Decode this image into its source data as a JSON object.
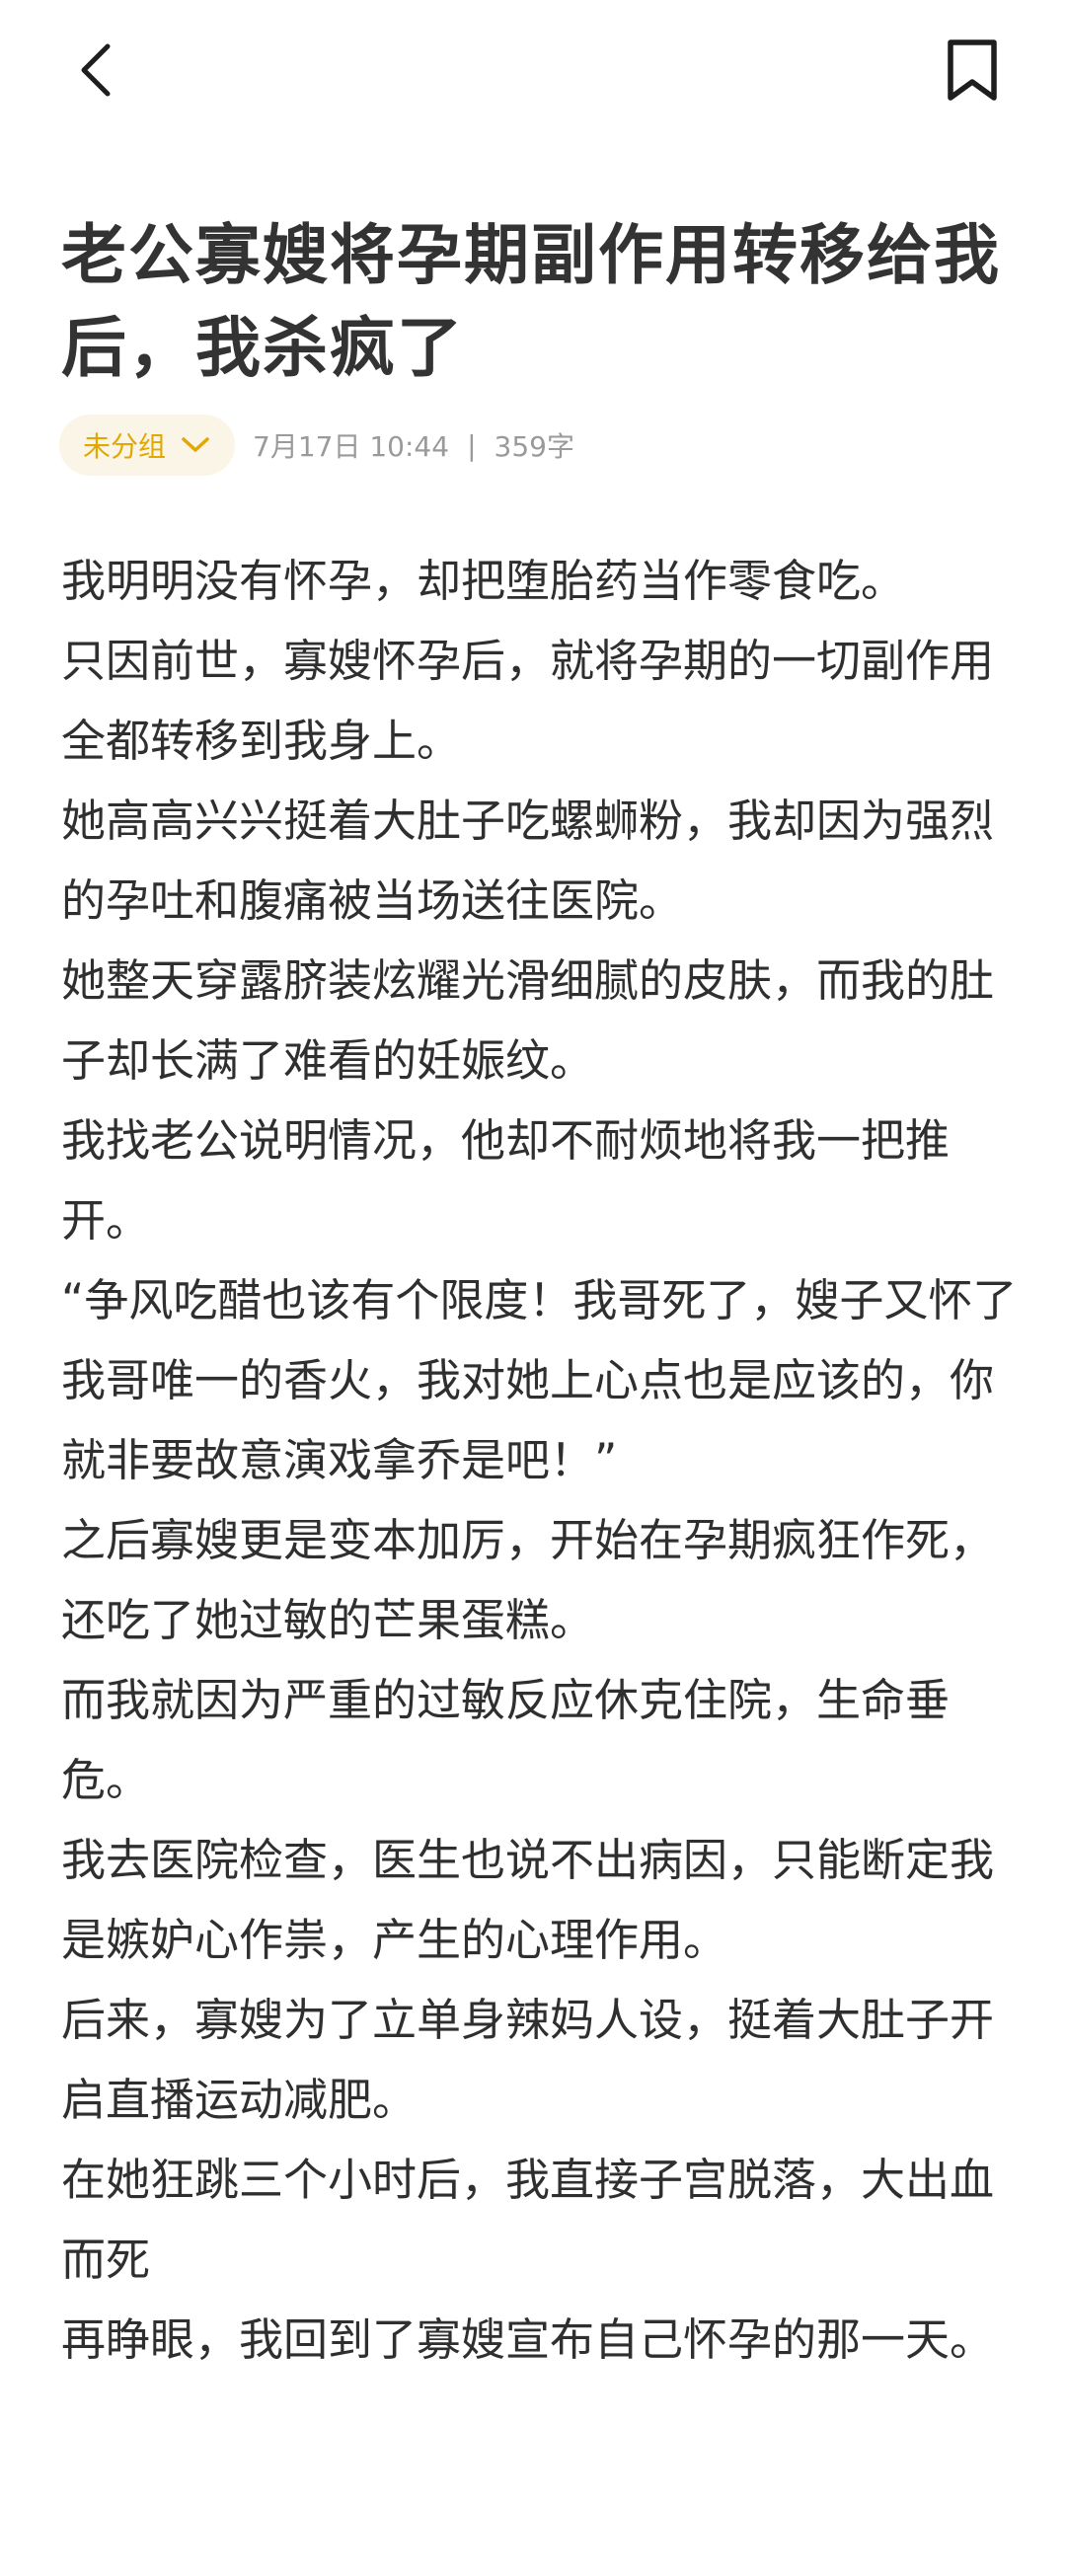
{
  "header": {
    "back_icon": "chevron-left-icon",
    "bookmark_icon": "bookmark-icon"
  },
  "article": {
    "title": "老公寡嫂将孕期副作用转移给我后，我杀疯了",
    "group_label": "未分组",
    "date_time": "7月17日 10:44",
    "separator": "|",
    "word_count": "359字",
    "accent_color": "#e0a800",
    "paragraphs": [
      "我明明没有怀孕，却把堕胎药当作零食吃。",
      "只因前世，寡嫂怀孕后，就将孕期的一切副作用全都转移到我身上。",
      "她高高兴兴挺着大肚子吃螺蛳粉，我却因为强烈的孕吐和腹痛被当场送往医院。",
      "她整天穿露脐装炫耀光滑细腻的皮肤，而我的肚子却长满了难看的妊娠纹。",
      "我找老公说明情况，他却不耐烦地将我一把推开。",
      "“争风吃醋也该有个限度！我哥死了，嫂子又怀了我哥唯一的香火，我对她上心点也是应该的，你就非要故意演戏拿乔是吧！”",
      "之后寡嫂更是变本加厉，开始在孕期疯狂作死，还吃了她过敏的芒果蛋糕。",
      "而我就因为严重的过敏反应休克住院，生命垂危。",
      "我去医院检查，医生也说不出病因，只能断定我是嫉妒心作祟，产生的心理作用。",
      "后来，寡嫂为了立单身辣妈人设，挺着大肚子开启直播运动减肥。",
      "在她狂跳三个小时后，我直接子宫脱落，大出血而死",
      "再睁眼，我回到了寡嫂宣布自己怀孕的那一天。"
    ]
  }
}
